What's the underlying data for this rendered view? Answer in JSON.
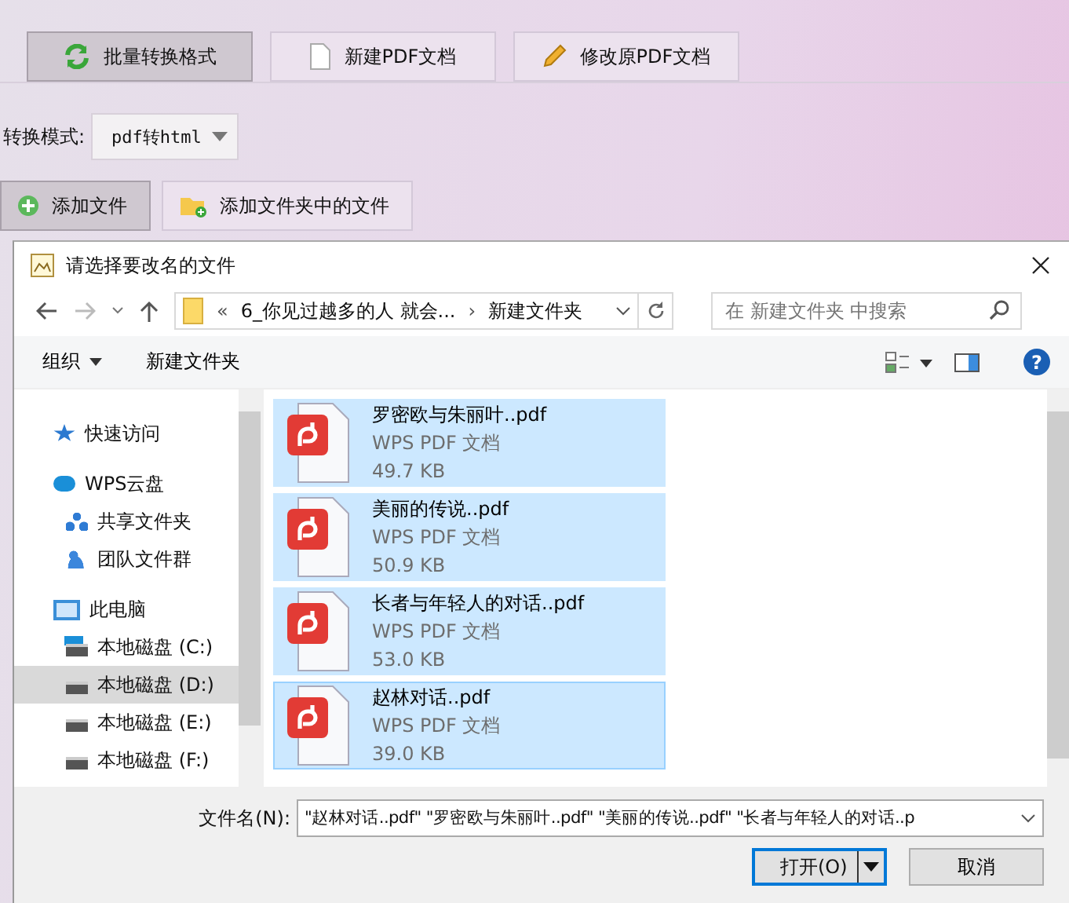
{
  "tabs": [
    {
      "label": "批量转换格式",
      "kind": "convert",
      "selected": true
    },
    {
      "label": "新建PDF文档",
      "kind": "page",
      "selected": false
    },
    {
      "label": "修改原PDF文档",
      "kind": "pencil",
      "selected": false
    }
  ],
  "mode": {
    "label": "转换模式:",
    "value": "pdf转html"
  },
  "add_buttons": [
    {
      "label": "添加文件",
      "kind": "plus",
      "pressed": true
    },
    {
      "label": "添加文件夹中的文件",
      "kind": "folder",
      "pressed": false
    }
  ],
  "dialog": {
    "title": "请选择要改名的文件",
    "address": {
      "overflow": "«",
      "folder": "6_你见过越多的人 就会...",
      "separator": "›",
      "current": "新建文件夹"
    },
    "search": {
      "placeholder": "在 新建文件夹 中搜索"
    },
    "toolbar": {
      "organize": "组织",
      "new_folder": "新建文件夹",
      "help": "?"
    },
    "nav": [
      {
        "label": "快速访问",
        "kind": "star",
        "selected": false
      },
      {
        "label": "WPS云盘",
        "kind": "cloud",
        "selected": false,
        "children": [
          {
            "label": "共享文件夹",
            "kind": "share",
            "selected": false
          },
          {
            "label": "团队文件群",
            "kind": "team",
            "selected": false
          }
        ]
      },
      {
        "label": "此电脑",
        "kind": "pc",
        "selected": false,
        "children": [
          {
            "label": "本地磁盘 (C:)",
            "kind": "sysdrive",
            "selected": false
          },
          {
            "label": "本地磁盘 (D:)",
            "kind": "drive",
            "selected": true
          },
          {
            "label": "本地磁盘 (E:)",
            "kind": "drive",
            "selected": false
          },
          {
            "label": "本地磁盘 (F:)",
            "kind": "drive",
            "selected": false
          }
        ]
      }
    ],
    "files": [
      {
        "name": "罗密欧与朱丽叶..pdf",
        "type": "WPS PDF 文档",
        "size": "49.7 KB",
        "selected": true
      },
      {
        "name": "美丽的传说..pdf",
        "type": "WPS PDF 文档",
        "size": "50.9 KB",
        "selected": true
      },
      {
        "name": "长者与年轻人的对话..pdf",
        "type": "WPS PDF 文档",
        "size": "53.0 KB",
        "selected": true
      },
      {
        "name": "赵林对话..pdf",
        "type": "WPS PDF 文档",
        "size": "39.0 KB",
        "selected": true
      }
    ],
    "filename": {
      "label": "文件名(N):",
      "value": "\"赵林对话..pdf\" \"罗密欧与朱丽叶..pdf\" \"美丽的传说..pdf\" \"长者与年轻人的对话..p"
    },
    "buttons": [
      {
        "label": "打开(O)",
        "kind": "primary"
      },
      {
        "label": "取消",
        "kind": "normal"
      }
    ]
  }
}
